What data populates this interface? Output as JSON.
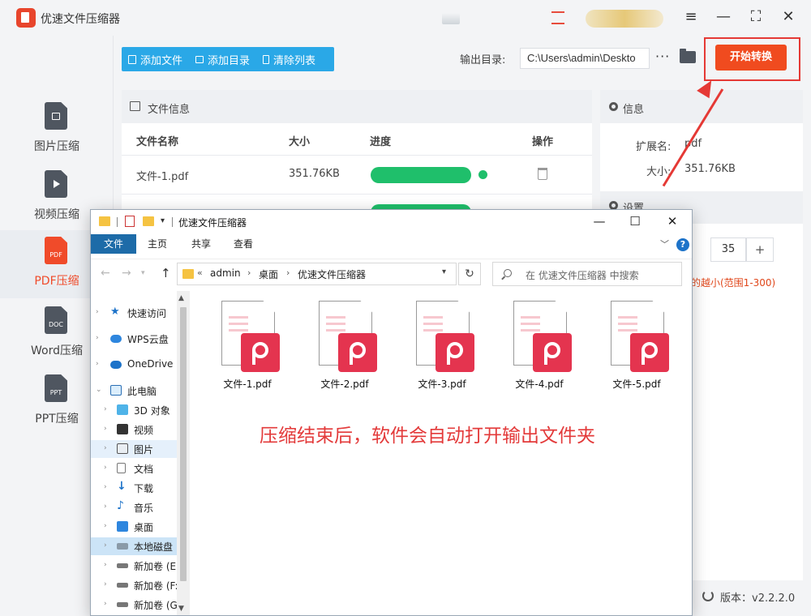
{
  "app": {
    "title": "优速文件压缩器",
    "window_controls": [
      "≡",
      "—",
      "⛶",
      "✕"
    ]
  },
  "sidebar": {
    "items": [
      {
        "label": "图片压缩",
        "icon": "image-file-icon",
        "active": false
      },
      {
        "label": "视频压缩",
        "icon": "video-file-icon",
        "active": false
      },
      {
        "label": "PDF压缩",
        "icon": "pdf-file-icon",
        "badge": "PDF",
        "active": true
      },
      {
        "label": "Word压缩",
        "icon": "doc-file-icon",
        "badge": "DOC",
        "active": false
      },
      {
        "label": "PPT压缩",
        "icon": "ppt-file-icon",
        "badge": "PPT",
        "active": false
      }
    ]
  },
  "toolbar": {
    "add_file": "添加文件",
    "add_folder": "添加目录",
    "clear_list": "清除列表",
    "output_label": "输出目录:",
    "output_path": "C:\\Users\\admin\\Deskto",
    "more": "···",
    "start_button": "开始转换"
  },
  "file_panel": {
    "title": "文件信息",
    "columns": [
      "文件名称",
      "大小",
      "进度",
      "操作"
    ],
    "rows": [
      {
        "name": "文件-1.pdf",
        "size": "351.76KB",
        "progress": 1.0,
        "status": "done"
      }
    ]
  },
  "info_panel": {
    "title": "信息",
    "ext_label": "扩展名:",
    "ext_value": "pdf",
    "size_label": "大小:",
    "size_value": "351.76KB"
  },
  "settings_panel": {
    "title": "设置",
    "quality_value": "35",
    "plus": "+",
    "hint": "的越小(范围1-300)"
  },
  "footer": {
    "version": "版本：v2.2.2.0"
  },
  "explorer": {
    "title": "优速文件压缩器",
    "window_controls": [
      "—",
      "☐",
      "✕"
    ],
    "ribbon_tabs": [
      "文件",
      "主页",
      "共享",
      "查看"
    ],
    "breadcrumbs": [
      "admin",
      "桌面",
      "优速文件压缩器"
    ],
    "breadcrumb_prefix": "«",
    "search_placeholder": "在 优速文件压缩器 中搜索",
    "nav_items": [
      {
        "label": "快速访问",
        "icon": "star-icon",
        "level": 0
      },
      {
        "label": "WPS云盘",
        "icon": "cloud-icon",
        "level": 0
      },
      {
        "label": "OneDrive",
        "icon": "onedrive-icon",
        "level": 0
      },
      {
        "label": "此电脑",
        "icon": "computer-icon",
        "level": 0,
        "expanded": true
      },
      {
        "label": "3D 对象",
        "icon": "cube-icon",
        "level": 1
      },
      {
        "label": "视频",
        "icon": "video-folder-icon",
        "level": 1
      },
      {
        "label": "图片",
        "icon": "pictures-folder-icon",
        "level": 1,
        "selected": true
      },
      {
        "label": "文档",
        "icon": "documents-folder-icon",
        "level": 1
      },
      {
        "label": "下载",
        "icon": "download-icon",
        "level": 1
      },
      {
        "label": "音乐",
        "icon": "music-icon",
        "level": 1
      },
      {
        "label": "桌面",
        "icon": "desktop-icon",
        "level": 1
      },
      {
        "label": "本地磁盘",
        "icon": "local-disk-icon",
        "level": 1,
        "highlighted": true
      },
      {
        "label": "新加卷 (E",
        "icon": "drive-icon",
        "level": 1
      },
      {
        "label": "新加卷 (F:",
        "icon": "drive-icon",
        "level": 1
      },
      {
        "label": "新加卷 (G",
        "icon": "drive-icon",
        "level": 1
      }
    ],
    "files": [
      "文件-1.pdf",
      "文件-2.pdf",
      "文件-3.pdf",
      "文件-4.pdf",
      "文件-5.pdf"
    ]
  },
  "annotation": {
    "caption": "压缩结束后，软件会自动打开输出文件夹",
    "color": "#e33a3a"
  },
  "colors": {
    "accent_orange": "#f04b1f",
    "toolbar_blue": "#2aa8e7",
    "progress_green": "#1fbf6b",
    "highlight_red": "#e53935"
  }
}
